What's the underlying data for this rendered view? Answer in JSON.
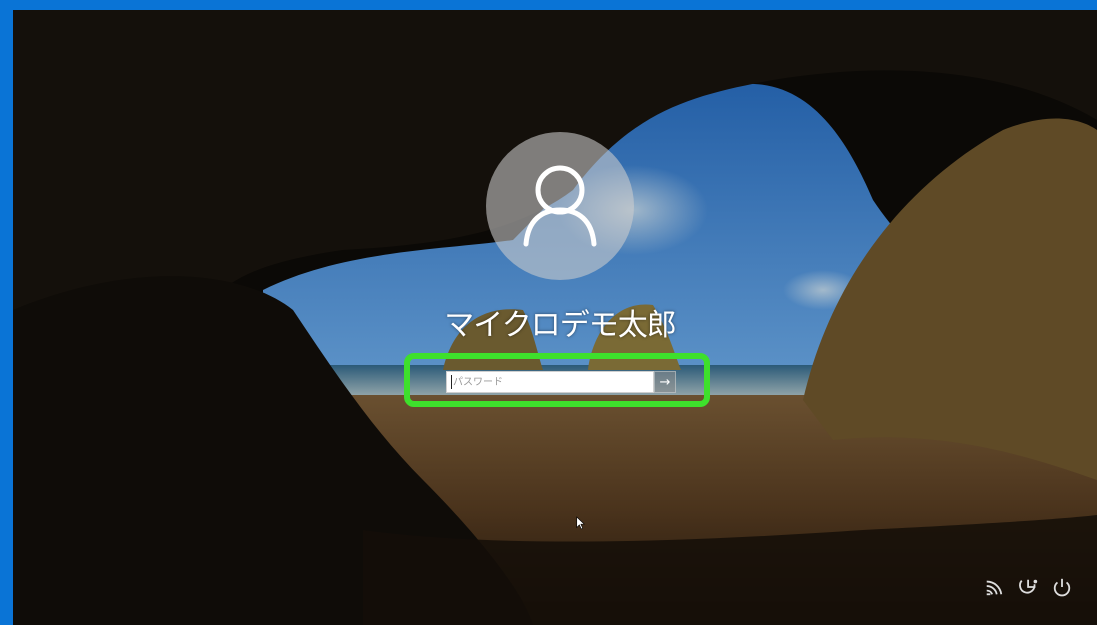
{
  "login": {
    "username": "マイクロデモ太郎",
    "password_placeholder": "パスワード",
    "submit_arrow": "→"
  },
  "icons": {
    "avatar": "user-avatar-icon",
    "network": "network-icon",
    "ease_of_access": "ease-of-access-icon",
    "power": "power-icon",
    "cursor": "mouse-cursor-icon"
  },
  "colors": {
    "frame": "#0a74d6",
    "highlight": "#3ee02c"
  }
}
